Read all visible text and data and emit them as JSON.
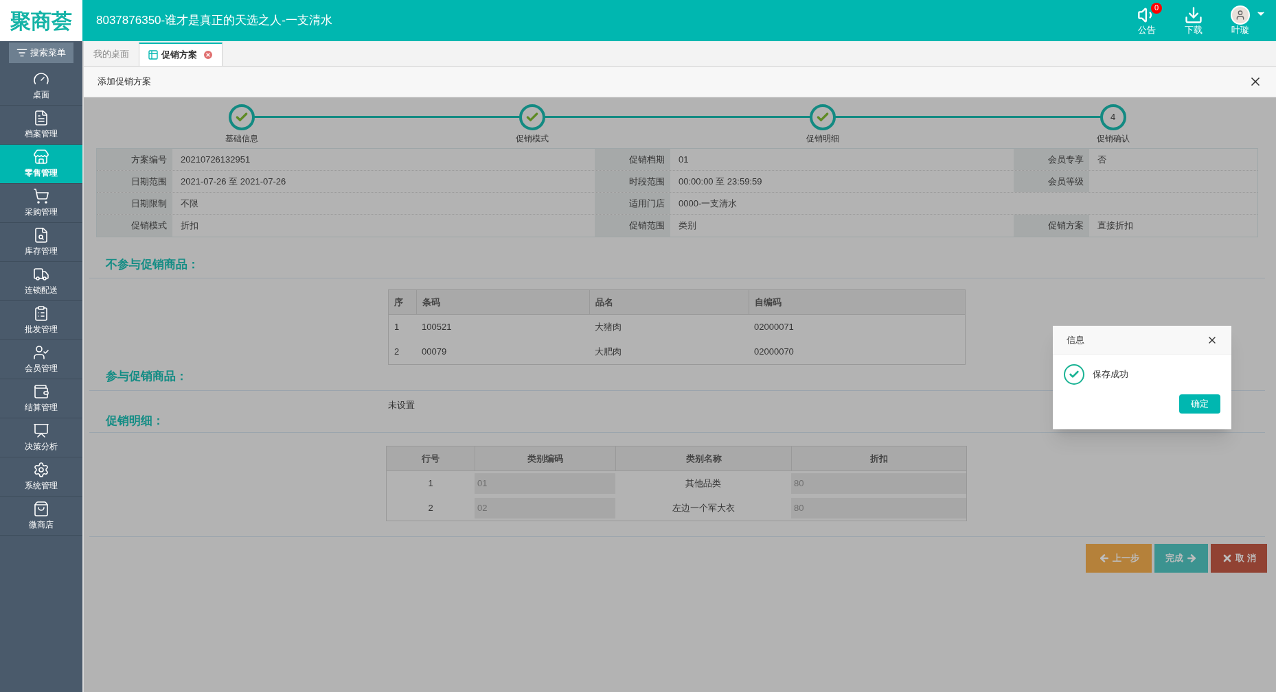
{
  "logo": "聚商荟",
  "header": {
    "title": "8037876350-谁才是真正的天选之人-一支清水",
    "actions": [
      {
        "kind": "notice",
        "label": "公告",
        "badge": "0"
      },
      {
        "kind": "download",
        "label": "下载"
      },
      {
        "kind": "user",
        "label": "叶璇"
      }
    ]
  },
  "sidebar": {
    "search": "搜索菜单",
    "items": [
      {
        "label": "桌面",
        "selected": false
      },
      {
        "label": "档案管理",
        "selected": false
      },
      {
        "label": "零售管理",
        "selected": true
      },
      {
        "label": "采购管理",
        "selected": false
      },
      {
        "label": "库存管理",
        "selected": false
      },
      {
        "label": "连锁配送",
        "selected": false
      },
      {
        "label": "批发管理",
        "selected": false
      },
      {
        "label": "会员管理",
        "selected": false
      },
      {
        "label": "结算管理",
        "selected": false
      },
      {
        "label": "决策分析",
        "selected": false
      },
      {
        "label": "系统管理",
        "selected": false
      },
      {
        "label": "微商店",
        "selected": false
      }
    ]
  },
  "tabs": [
    {
      "label": "我的桌面",
      "selected": false
    },
    {
      "label": "促销方案",
      "selected": true
    }
  ],
  "panel_title": "添加促销方案",
  "steps": [
    {
      "label": "基础信息",
      "done": true
    },
    {
      "label": "促销模式",
      "done": true
    },
    {
      "label": "促销明细",
      "done": true
    },
    {
      "label": "促销确认",
      "done": false,
      "number": "4"
    }
  ],
  "info": [
    [
      {
        "label": "方案编号",
        "value": "20210726132951"
      },
      {
        "label": "促销档期",
        "value": "01"
      },
      {
        "label": "会员专享",
        "value": "否"
      }
    ],
    [
      {
        "label": "日期范围",
        "value": "2021-07-26 至 2021-07-26"
      },
      {
        "label": "时段范围",
        "value": "00:00:00 至 23:59:59"
      },
      {
        "label": "会员等级"
      }
    ],
    [
      {
        "label": "日期限制",
        "value": "不限"
      },
      {
        "label": "适用门店",
        "value": "0000-一支清水"
      }
    ],
    [
      {
        "label": "促销模式",
        "value": "折扣"
      },
      {
        "label": "促销范围",
        "value": "类别"
      },
      {
        "label": "促销方案",
        "value": "直接折扣"
      }
    ]
  ],
  "excluded": {
    "heading": "不参与促销商品：",
    "columns": [
      "序",
      "条码",
      "品名",
      "自编码"
    ],
    "rows": [
      [
        "1",
        "100521",
        "大猪肉",
        "02000071"
      ],
      [
        "2",
        "00079",
        "大肥肉",
        "02000070"
      ]
    ]
  },
  "included": {
    "heading": "参与促销商品：",
    "empty_text": "未设置"
  },
  "details": {
    "heading": "促销明细：",
    "columns": [
      {
        "label": "行号",
        "kind": "text"
      },
      {
        "label": "类别编码",
        "kind": "field"
      },
      {
        "label": "类别名称",
        "kind": "text"
      },
      {
        "label": "折扣",
        "kind": "field"
      }
    ],
    "rows": [
      [
        "1",
        "01",
        "其他品类",
        "80"
      ],
      [
        "2",
        "02",
        "左边一个军大衣",
        "80"
      ]
    ]
  },
  "buttons": [
    {
      "kind": "prev",
      "label": "上一步"
    },
    {
      "kind": "finish",
      "label": "完成"
    },
    {
      "kind": "cancel",
      "label": "取 消"
    }
  ],
  "dialog": {
    "title": "信息",
    "message": "保存成功",
    "confirm": "确定"
  }
}
